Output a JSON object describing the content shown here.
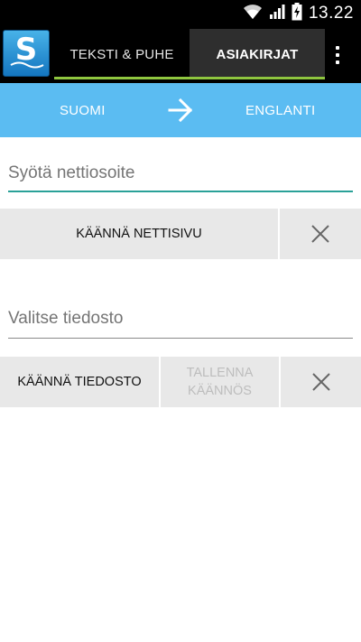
{
  "status_bar": {
    "time": "13.22",
    "icons": [
      "wifi-icon",
      "signal-icon",
      "battery-charging-icon"
    ]
  },
  "action_bar": {
    "logo_letter": "S",
    "tabs": [
      {
        "label": "TEKSTI & PUHE",
        "selected": false
      },
      {
        "label": "ASIAKIRJAT",
        "selected": true
      }
    ],
    "overflow_icon": "more-vert-icon",
    "accent_color": "#8fc63f"
  },
  "language_bar": {
    "source": "SUOMI",
    "target": "ENGLANTI",
    "arrow_icon": "arrow-right-icon",
    "background": "#5bbcf2"
  },
  "url_section": {
    "placeholder": "Syötä nettiosoite",
    "value": "",
    "translate_label": "KÄÄNNÄ NETTISIVU",
    "clear_icon": "close-icon"
  },
  "file_section": {
    "placeholder": "Valitse tiedosto",
    "value": "",
    "translate_label": "KÄÄNNÄ TIEDOSTO",
    "save_label_line1": "TALLENNA",
    "save_label_line2": "KÄÄNNÖS",
    "save_enabled": false,
    "clear_icon": "close-icon"
  }
}
